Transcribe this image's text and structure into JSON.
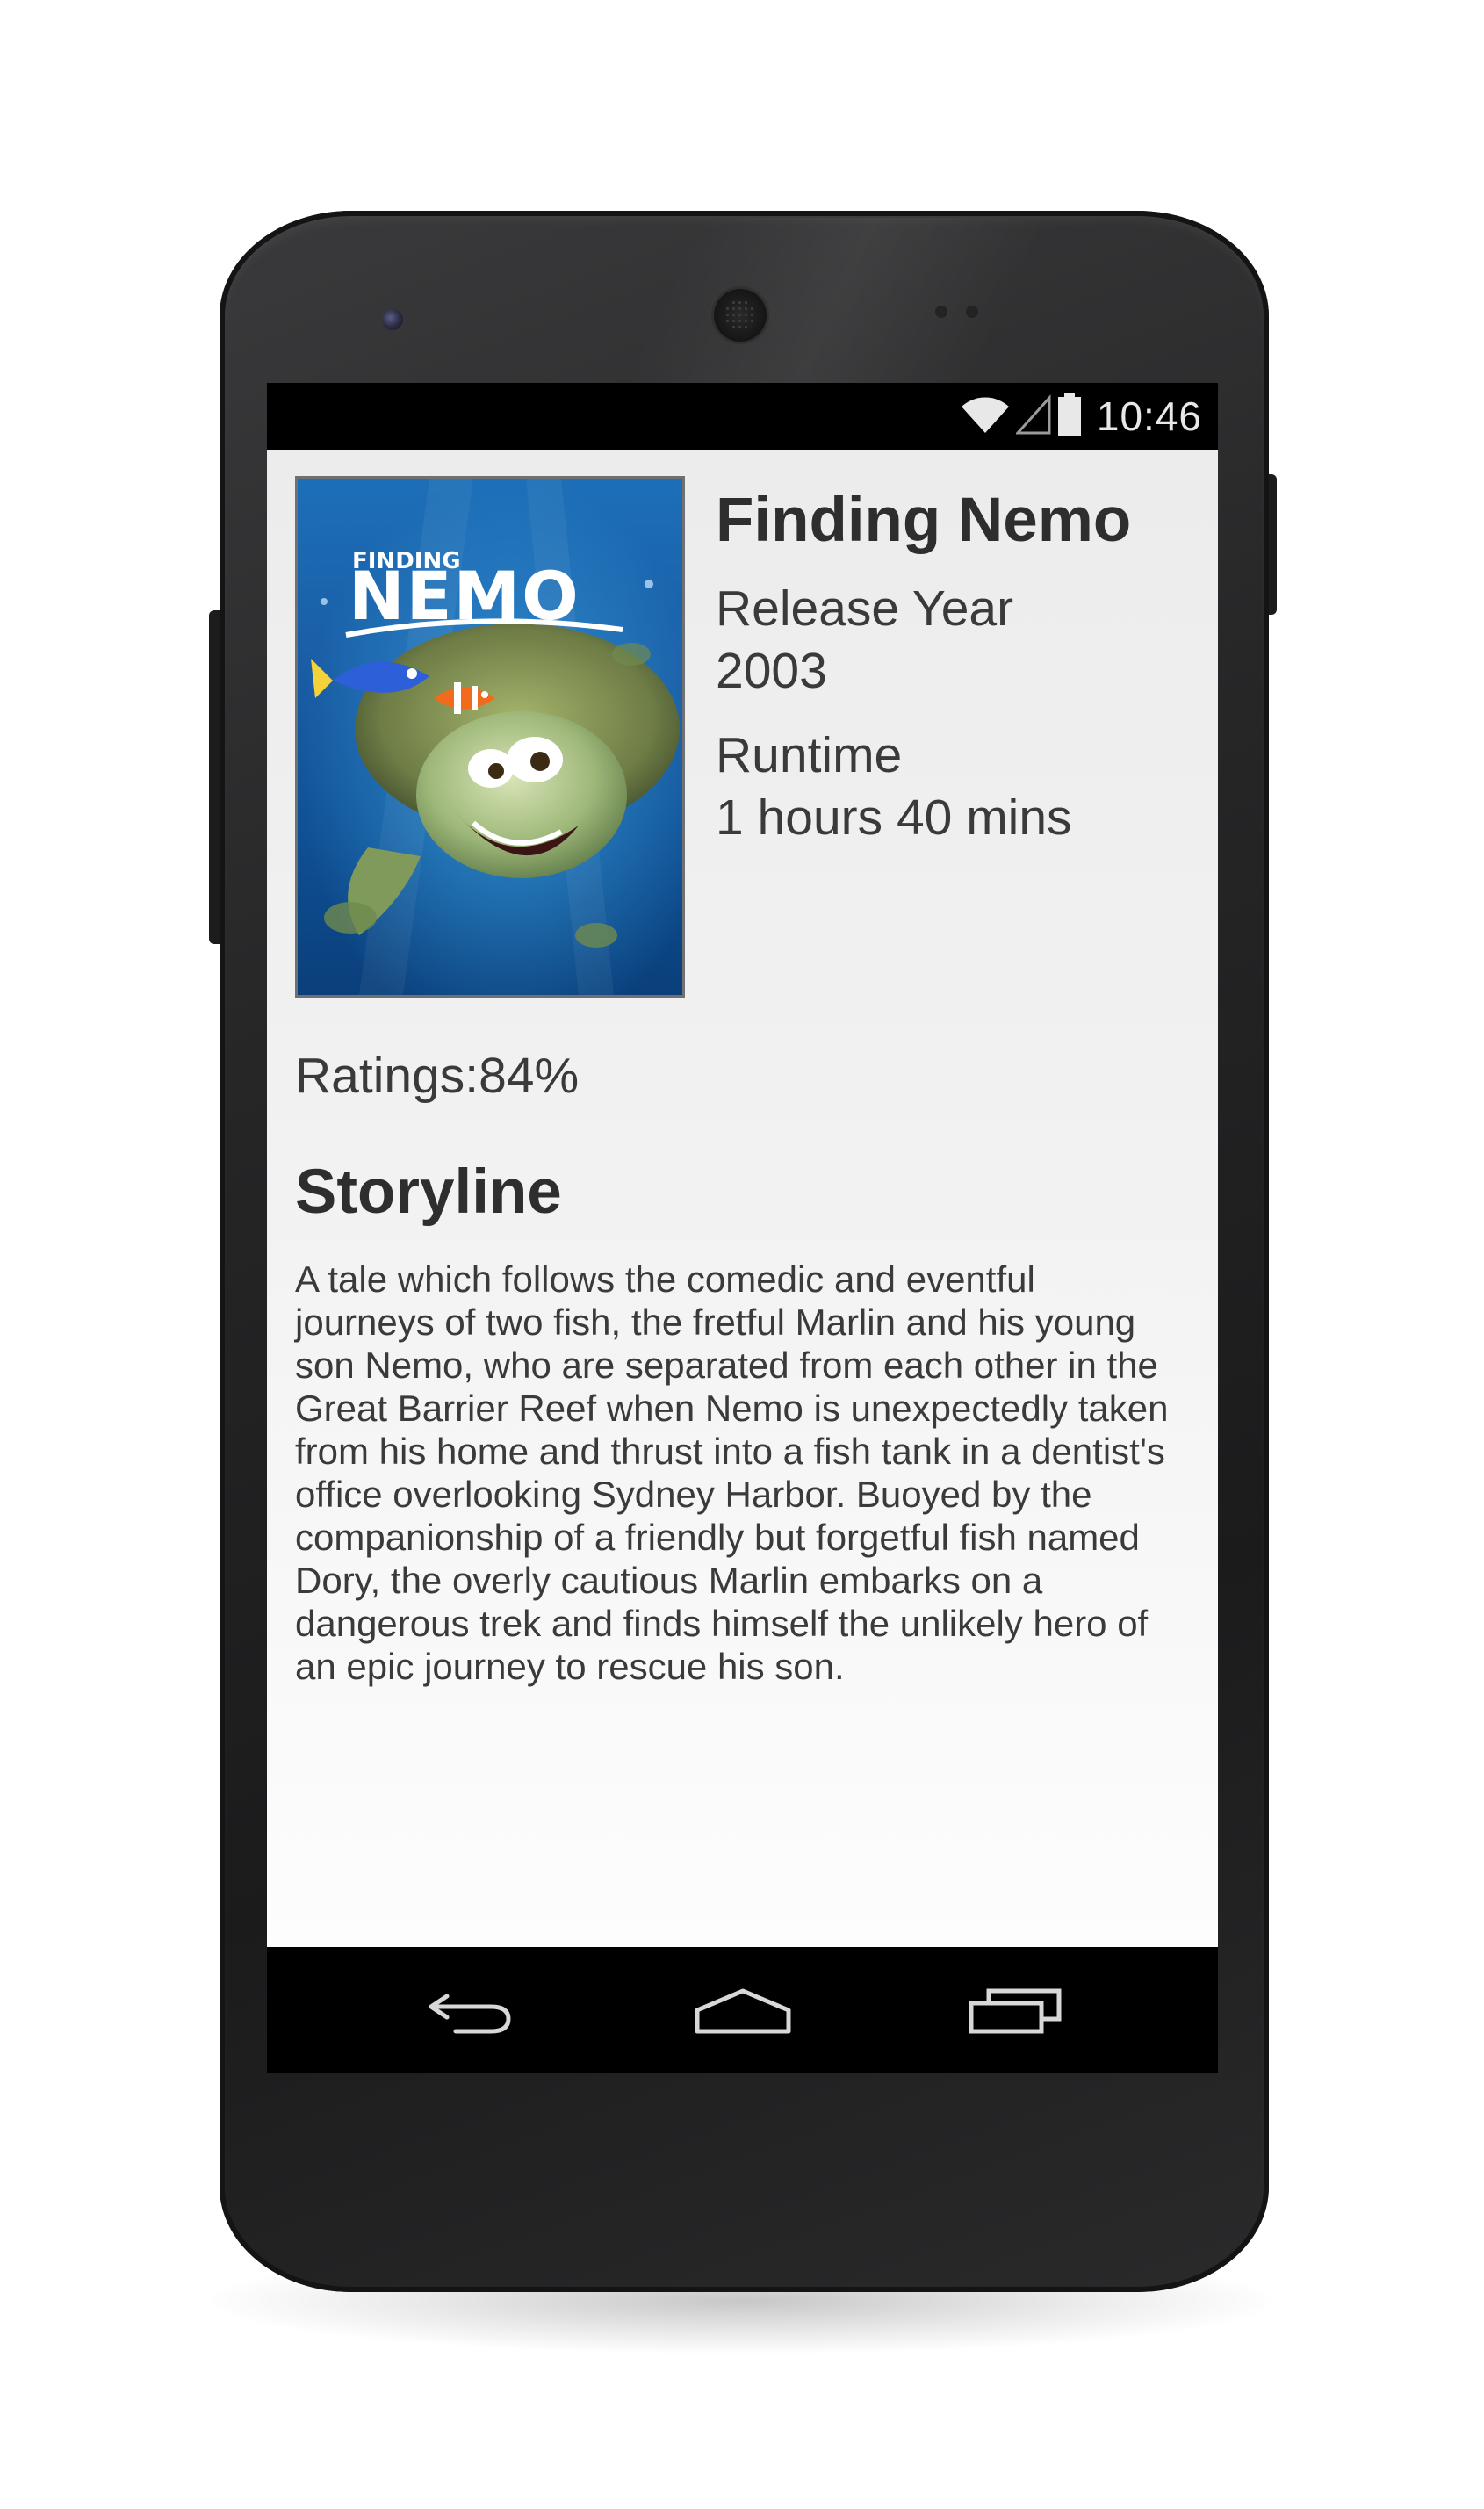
{
  "status_bar": {
    "time": "10:46",
    "icons": [
      "wifi-icon",
      "cell-signal-icon",
      "battery-icon"
    ]
  },
  "movie": {
    "title": "Finding Nemo",
    "poster_title_small": "FINDING",
    "poster_title_large": "NEMO",
    "release_year_label": "Release Year",
    "release_year": "2003",
    "runtime_label": "Runtime",
    "runtime": "1 hours 40 mins",
    "ratings": "Ratings:84%",
    "storyline_heading": "Storyline",
    "storyline": "A tale which follows the comedic and eventful journeys of two fish, the fretful Marlin and his young son Nemo, who are separated from each other in the Great Barrier Reef when Nemo is unexpectedly taken from his home and thrust into a fish tank in a dentist's office overlooking Sydney Harbor. Buoyed by the companionship of a friendly but forgetful fish named Dory, the overly cautious Marlin embarks on a dangerous trek and finds himself the unlikely hero of an epic journey to rescue his son."
  },
  "nav_bar": {
    "buttons": [
      "back-icon",
      "home-icon",
      "recent-apps-icon"
    ]
  },
  "colors": {
    "content_bg": "#f0f0f0",
    "text": "#3a3a3a",
    "title_text": "#2e2e2e",
    "bars": "#000000",
    "device_body": "#262627"
  }
}
